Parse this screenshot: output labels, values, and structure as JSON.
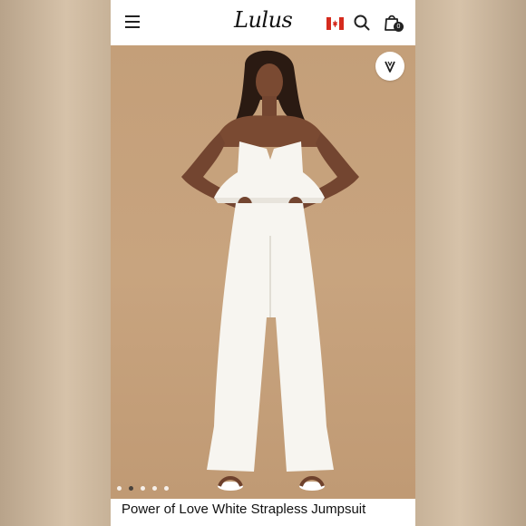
{
  "header": {
    "logo": "Lulus",
    "cart_count": "0",
    "icons": {
      "menu": "hamburger-menu-icon",
      "flag": "canada-flag-icon",
      "search": "search-icon",
      "cart": "shopping-bag-icon"
    }
  },
  "gallery": {
    "wishlist_icon": "heart-icon",
    "dot_count": 5,
    "active_dot": 1
  },
  "product": {
    "title": "Power of Love White Strapless Jumpsuit"
  },
  "colors": {
    "backdrop": "#c49f79",
    "garment": "#f7f5f0"
  }
}
